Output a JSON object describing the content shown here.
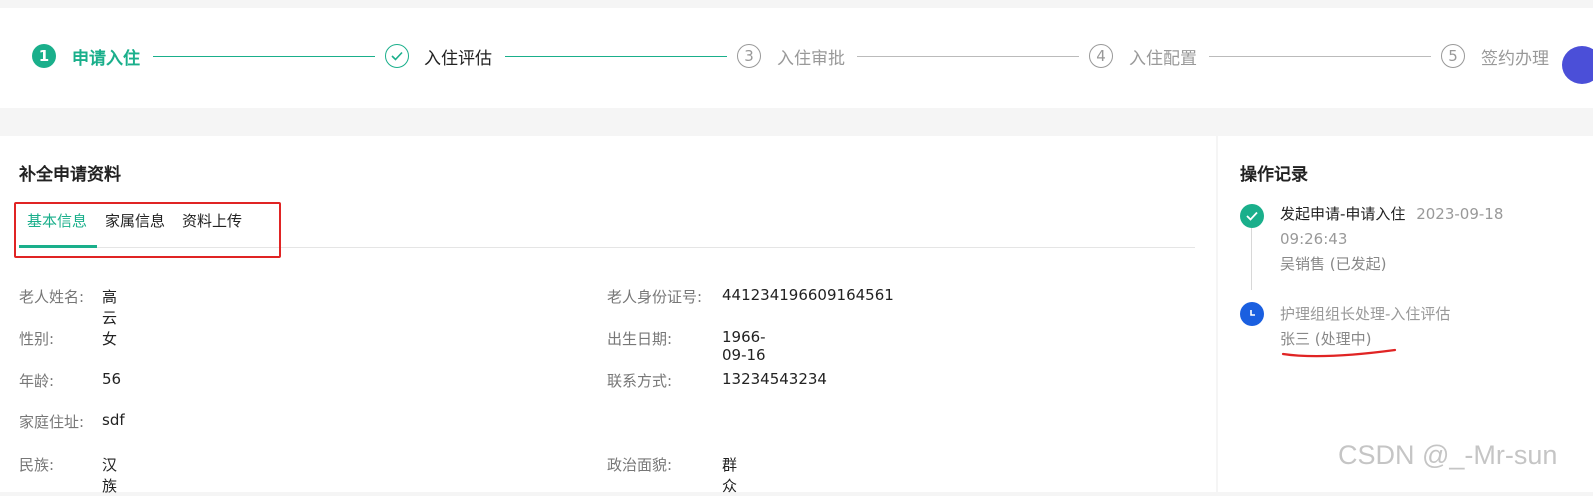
{
  "steps": [
    {
      "num": "1",
      "label": "申请入住",
      "state": "active"
    },
    {
      "num": "",
      "label": "入住评估",
      "state": "done"
    },
    {
      "num": "3",
      "label": "入住审批",
      "state": "wait"
    },
    {
      "num": "4",
      "label": "入住配置",
      "state": "wait"
    },
    {
      "num": "5",
      "label": "签约办理",
      "state": "wait"
    }
  ],
  "main": {
    "title": "补全申请资料",
    "tabs": [
      "基本信息",
      "家属信息",
      "资料上传"
    ],
    "active_tab": "基本信息",
    "fields_left": [
      {
        "label": "老人姓名:",
        "value": "高云"
      },
      {
        "label": "性别:",
        "value": "女"
      },
      {
        "label": "年龄:",
        "value": "56"
      },
      {
        "label": "家庭住址:",
        "value": "sdf"
      },
      {
        "label": "民族:",
        "value": "汉族"
      }
    ],
    "fields_right": [
      {
        "label": "老人身份证号:",
        "value": "441234196609164561"
      },
      {
        "label": "出生日期:",
        "value": "1966-09-16"
      },
      {
        "label": "联系方式:",
        "value": "13234543234"
      },
      {
        "label": "政治面貌:",
        "value": "群众"
      }
    ]
  },
  "side": {
    "title": "操作记录",
    "records": [
      {
        "title": "发起申请-申请入住",
        "time_a": "2023-09-18",
        "time_b": "09:26:43",
        "operator": "吴销售 (已发起)",
        "status": "done"
      },
      {
        "title": "护理组组长处理-入住评估",
        "operator": "张三 (处理中)",
        "status": "pending"
      }
    ]
  },
  "watermark": "CSDN @_-Mr-sun",
  "colors": {
    "accent": "#1aaf8b",
    "pending": "#1a5fe0",
    "highlight": "#e02424"
  }
}
